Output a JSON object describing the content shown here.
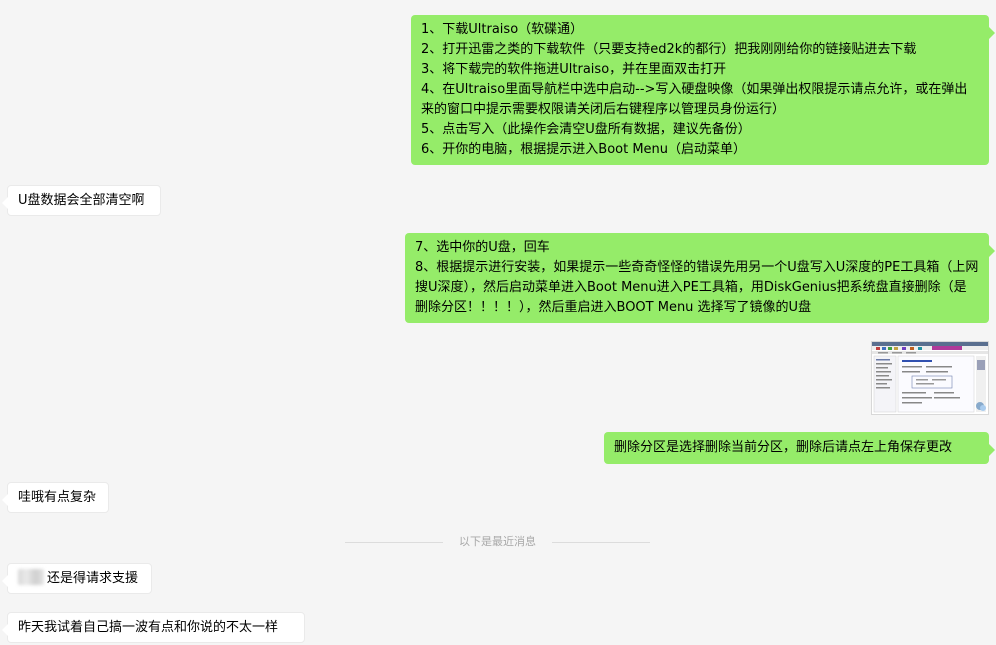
{
  "messages": {
    "msg1": {
      "sender": "self",
      "lines": [
        "1、下载Ultraiso（软碟通）",
        "2、打开迅雷之类的下载软件（只要支持ed2k的都行）把我刚刚给你的链接贴进去下载",
        "3、将下载完的软件拖进Ultraiso，并在里面双击打开",
        "4、在Ultraiso里面导航栏中选中启动-->写入硬盘映像（如果弹出权限提示请点允许，或在弹出来的窗口中提示需要权限请关闭后右键程序以管理员身份运行）",
        "5、点击写入（此操作会清空U盘所有数据，建议先备份）",
        "6、开你的电脑，根据提示进入Boot Menu（启动菜单）"
      ]
    },
    "msg2": {
      "sender": "other",
      "text": "U盘数据会全部清空啊"
    },
    "msg3": {
      "sender": "self",
      "lines": [
        "7、选中你的U盘，回车",
        "8、根据提示进行安装，如果提示一些奇奇怪怪的错误先用另一个U盘写入U深度的PE工具箱（上网搜U深度），然后启动菜单进入Boot Menu进入PE工具箱，用DiskGenius把系统盘直接删除（是删除分区！！！！），然后重启进入BOOT Menu 选择写了镜像的U盘"
      ]
    },
    "msg4": {
      "sender": "self",
      "text": "删除分区是选择删除当前分区，删除后请点左上角保存更改"
    },
    "msg5": {
      "sender": "other",
      "text": "哇哦有点复杂"
    },
    "msg6": {
      "sender": "other",
      "text": "还是得请求支援"
    },
    "msg7": {
      "sender": "other",
      "text": "昨天我试着自己搞一波有点和你说的不太一样"
    }
  },
  "separator": {
    "text": "以下是最近消息"
  },
  "image_attachment": {
    "icon": "screenshot-thumbnail"
  },
  "colors": {
    "self_bubble": "#95ec69",
    "other_bubble": "#ffffff",
    "background": "#f5f5f5",
    "separator_text": "#a8a8a8"
  }
}
